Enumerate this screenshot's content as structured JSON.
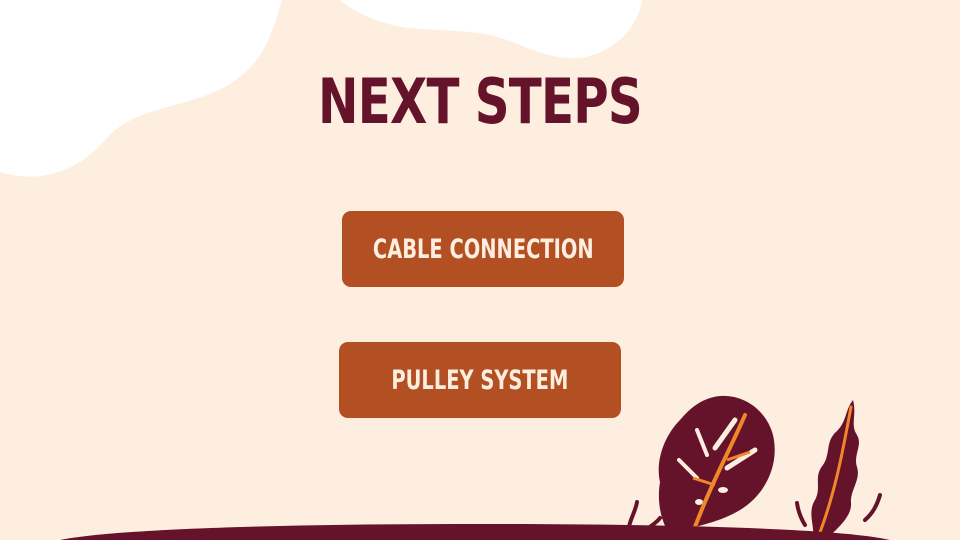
{
  "slide": {
    "title": "NEXT STEPS",
    "steps": [
      {
        "label": "CABLE CONNECTION"
      },
      {
        "label": "PULLEY SYSTEM"
      }
    ]
  },
  "colors": {
    "background": "#fdeee0",
    "blob": "#ffffff",
    "title": "#65132b",
    "button": "#b35023",
    "button_text": "#fdeee0",
    "plant": "#65132b",
    "plant_vein": "#f0882a"
  },
  "icons": {
    "monstera_leaf": "monstera-leaf-icon",
    "fern_leaf": "fern-leaf-icon"
  }
}
